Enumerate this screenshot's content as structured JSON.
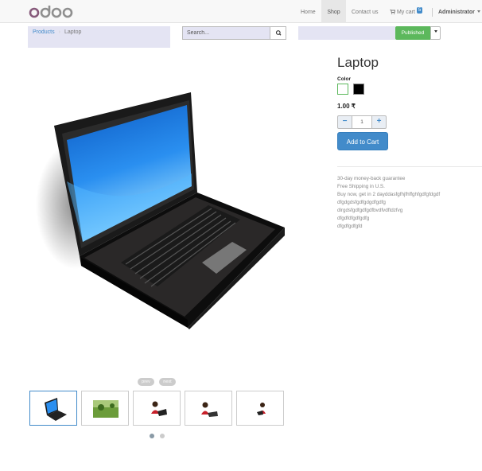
{
  "navbar": {
    "logo_text": "odoo",
    "items": [
      {
        "label": "Home"
      },
      {
        "label": "Shop"
      },
      {
        "label": "Contact us"
      },
      {
        "label": "My cart"
      }
    ],
    "cart_count": "5",
    "user": "Administrator"
  },
  "breadcrumb": {
    "parent": "Products",
    "current": "Laptop"
  },
  "search": {
    "placeholder": "Search..."
  },
  "publish": {
    "label": "Published"
  },
  "product": {
    "title": "Laptop",
    "color_label": "Color",
    "colors": [
      "#ffffff",
      "#000000"
    ],
    "price": "1.00 ₹",
    "quantity": "1",
    "add_to_cart": "Add to Cart",
    "description_lines": [
      "30-day money-back guarantee",
      "Free Shipping in U.S.",
      "Buy now, get in 2 dayddasfgfhjfhffghfgdfgfdgdf",
      "dfgdgdsfgdfgdgdfgdfg",
      "dlrgdsfgdfgdfgdfbvdfvdftdzfvg",
      "dfgdfdfgdfgdfg",
      "dfgdfgdfgfd"
    ]
  },
  "carousel": {
    "prev_label": "prev",
    "next_label": "next",
    "thumbnail_count": 5,
    "active_thumbnail": 1,
    "dots": 2,
    "active_dot": 1
  },
  "colors": {
    "brand_purple": "#875a7b",
    "primary": "#428bca",
    "success": "#5cb85c"
  }
}
